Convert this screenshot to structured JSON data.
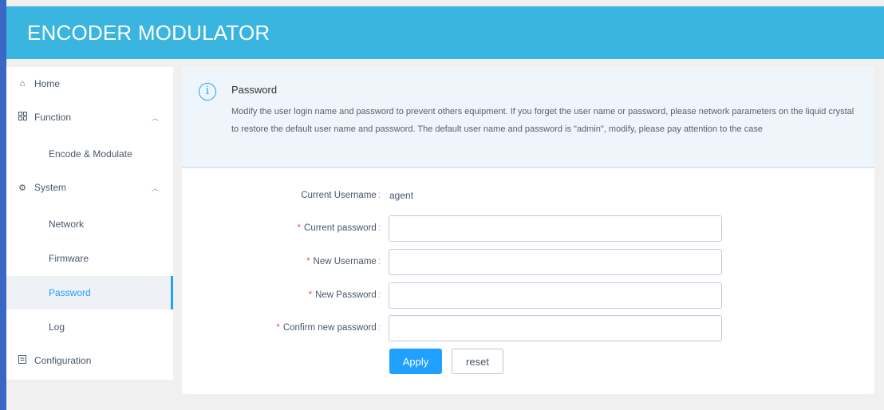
{
  "header": {
    "title": "ENCODER MODULATOR"
  },
  "sidebar": {
    "items": [
      {
        "label": "Home",
        "icon": "home-icon"
      },
      {
        "label": "Function",
        "icon": "grid-icon",
        "expanded": true
      },
      {
        "label": "Encode & Modulate",
        "sub": true
      },
      {
        "label": "System",
        "icon": "gear-icon",
        "expanded": true
      },
      {
        "label": "Network",
        "sub": true
      },
      {
        "label": "Firmware",
        "sub": true
      },
      {
        "label": "Password",
        "sub": true,
        "active": true
      },
      {
        "label": "Log",
        "sub": true
      },
      {
        "label": "Configuration",
        "icon": "document-icon"
      }
    ]
  },
  "alert": {
    "title": "Password",
    "description": "Modify the user login name and password to prevent others equipment. If you forget the user name or password, please network parameters on the liquid crystal to restore the default user name and password. The default user name and password is \"admin\", modify, please pay attention to the case"
  },
  "form": {
    "current_username_label": "Current Username",
    "current_username_value": "agent",
    "current_password_label": "Current password",
    "current_password_value": "",
    "new_username_label": "New Username",
    "new_username_value": "",
    "new_password_label": "New Password",
    "new_password_value": "",
    "confirm_password_label": "Confirm new password",
    "confirm_password_value": "",
    "apply_label": "Apply",
    "reset_label": "reset"
  },
  "colors": {
    "header_bg": "#39b5e0",
    "accent": "#20a0ff",
    "required": "#ff4949",
    "alert_bg": "#eef6fc"
  }
}
